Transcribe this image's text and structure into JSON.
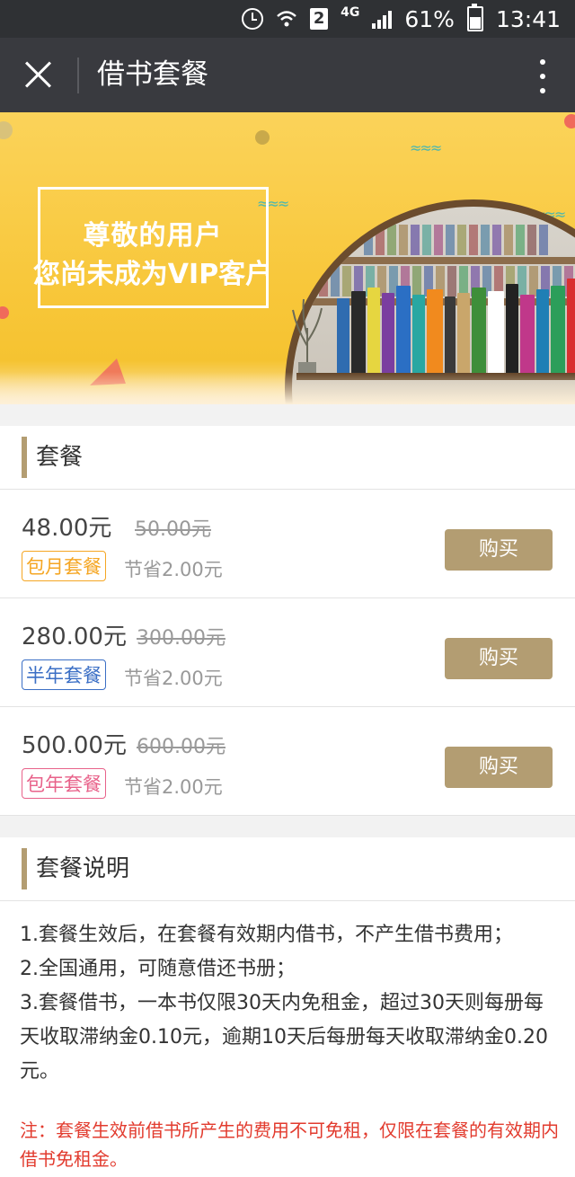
{
  "status_bar": {
    "network": "4G",
    "sim_slot": "2",
    "battery": "61%",
    "time": "13:41",
    "icons": [
      "alarm-icon",
      "wifi-icon",
      "sim-icon",
      "signal-icon",
      "battery-icon"
    ]
  },
  "title_bar": {
    "title": "借书套餐",
    "icons": [
      "close-icon",
      "more-icon"
    ]
  },
  "banner": {
    "line1": "尊敬的用户",
    "line2": "您尚未成为VIP客户"
  },
  "plans_section": {
    "title": "套餐",
    "plans": [
      {
        "price": "48.00元",
        "original_price": "50.00元",
        "tag": "包月套餐",
        "tag_color": "#f5a623",
        "saving": "节省2.00元",
        "button": "购买"
      },
      {
        "price": "280.00元",
        "original_price": "300.00元",
        "tag": "半年套餐",
        "tag_color": "#3b6fc5",
        "saving": "节省2.00元",
        "button": "购买"
      },
      {
        "price": "500.00元",
        "original_price": "600.00元",
        "tag": "包年套餐",
        "tag_color": "#e8628a",
        "saving": "节省2.00元",
        "button": "购买"
      }
    ]
  },
  "description_section": {
    "title": "套餐说明",
    "items": [
      "1.套餐生效后，在套餐有效期内借书，不产生借书费用；",
      "2.全国通用，可随意借还书册；",
      "3.套餐借书，一本书仅限30天内免租金，超过30天则每册每天收取滞纳金0.10元，逾期10天后每册每天收取滞纳金0.20元。"
    ],
    "note": "注：套餐生效前借书所产生的费用不可免租，仅限在套餐的有效期内借书免租金。"
  },
  "colors": {
    "accent": "#b39d72",
    "title_bar": "#393a3f",
    "status_bar": "#2f3134",
    "note": "#e23b2e"
  }
}
